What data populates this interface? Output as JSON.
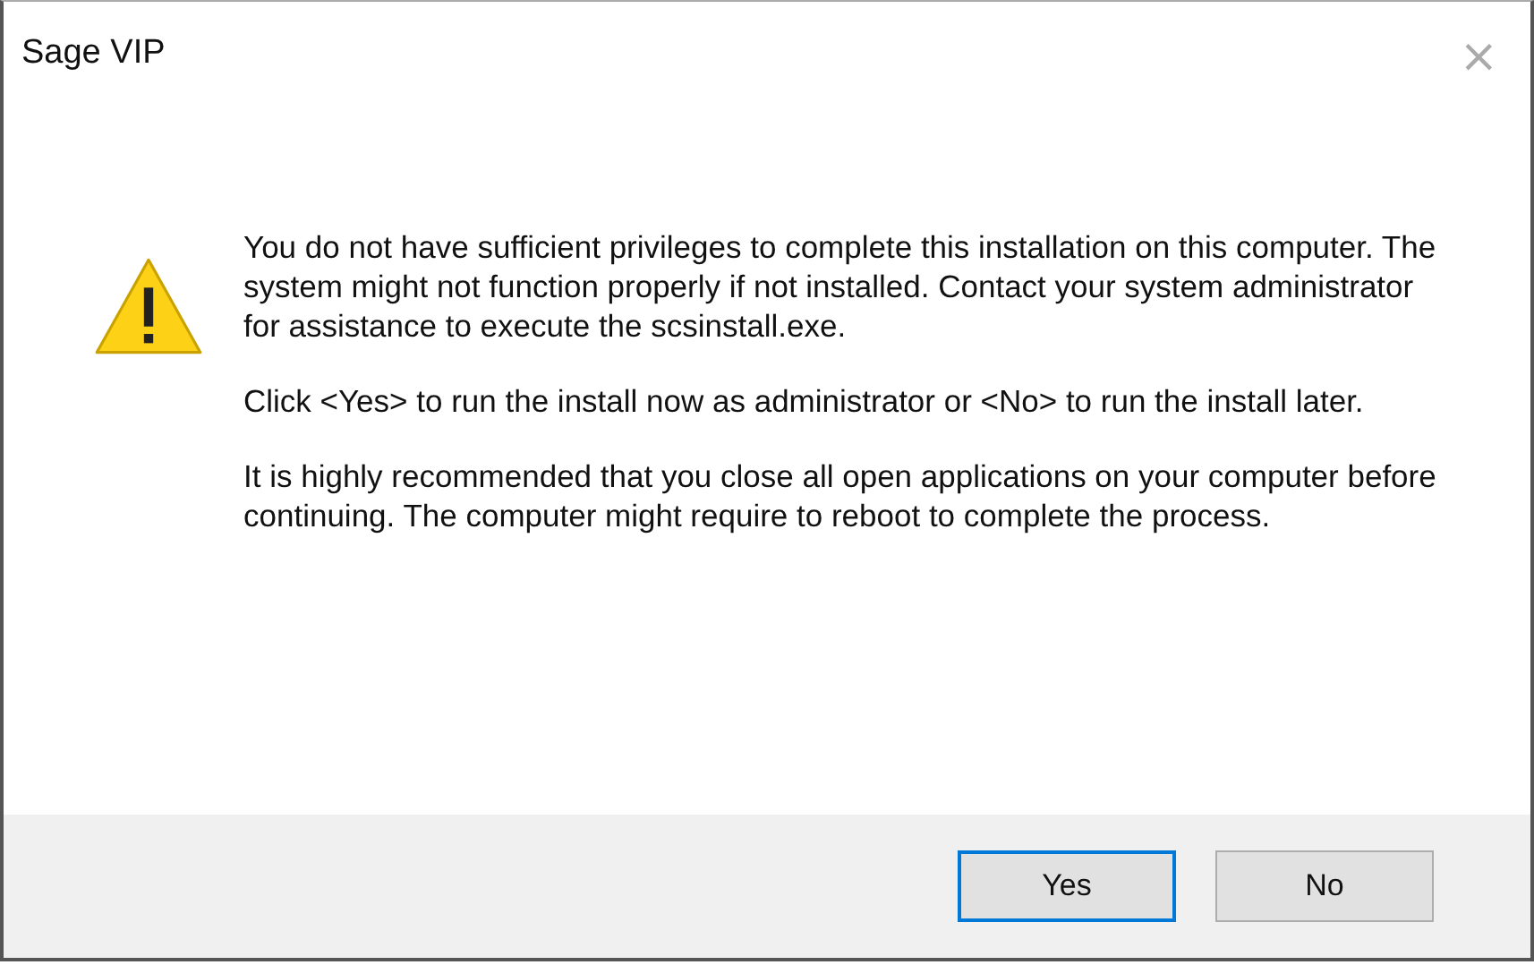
{
  "window": {
    "title": "Sage VIP",
    "close": "×"
  },
  "message": [
    "You do not have sufficient privileges to complete this installation on this computer. The system might not function properly if not installed. Contact your system administrator for assistance to execute the scsinstall.exe.",
    "Click <Yes> to run the install now as administrator or <No> to run the install later.",
    "It is highly recommended that you close all open applications on your computer before continuing. The computer might require to reboot to complete the process."
  ],
  "buttons": [
    {
      "label": "Yes",
      "selected": true
    },
    {
      "label": "No",
      "selected": false
    }
  ]
}
